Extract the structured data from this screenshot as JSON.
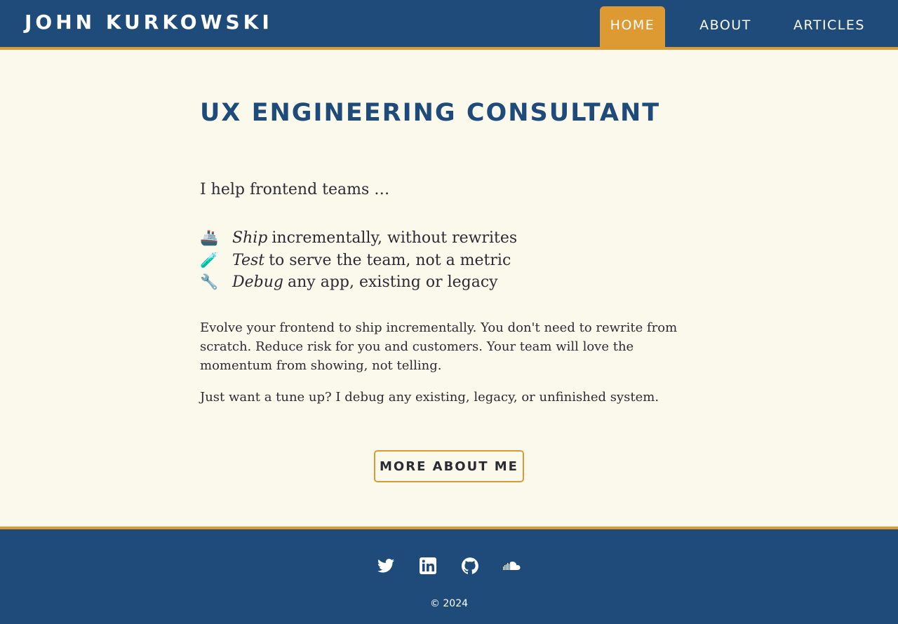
{
  "header": {
    "site_name": "JOHN KURKOWSKI",
    "nav": [
      {
        "label": "HOME",
        "active": true
      },
      {
        "label": "ABOUT",
        "active": false
      },
      {
        "label": "ARTICLES",
        "active": false
      }
    ]
  },
  "main": {
    "title": "UX ENGINEERING CONSULTANT",
    "intro": "I help frontend teams …",
    "bullets": [
      {
        "icon": "ship-icon",
        "emoji": "🚢",
        "emphasis": "Ship",
        "text": "incrementally, without rewrites"
      },
      {
        "icon": "test-tube-icon",
        "emoji": "🧪",
        "emphasis": "Test",
        "text": "to serve the team, not a metric"
      },
      {
        "icon": "wrench-icon",
        "emoji": "🔧",
        "emphasis": "Debug",
        "text": "any app, existing or legacy"
      }
    ],
    "paragraphs": [
      "Evolve your frontend to ship incrementally. You don't need to rewrite from scratch. Reduce risk for you and customers. Your team will love the momentum from showing, not telling.",
      "Just want a tune up? I debug any existing, legacy, or unfinished system."
    ],
    "cta_label": "MORE ABOUT ME"
  },
  "footer": {
    "social": [
      "twitter-icon",
      "linkedin-icon",
      "github-icon",
      "soundcloud-icon"
    ],
    "copyright": "© 2024"
  },
  "colors": {
    "header_bg": "#1f4b7a",
    "accent": "#dd9a33",
    "page_bg": "#fbf9ec",
    "title": "#1f4b7a",
    "text": "#2b2b33"
  }
}
